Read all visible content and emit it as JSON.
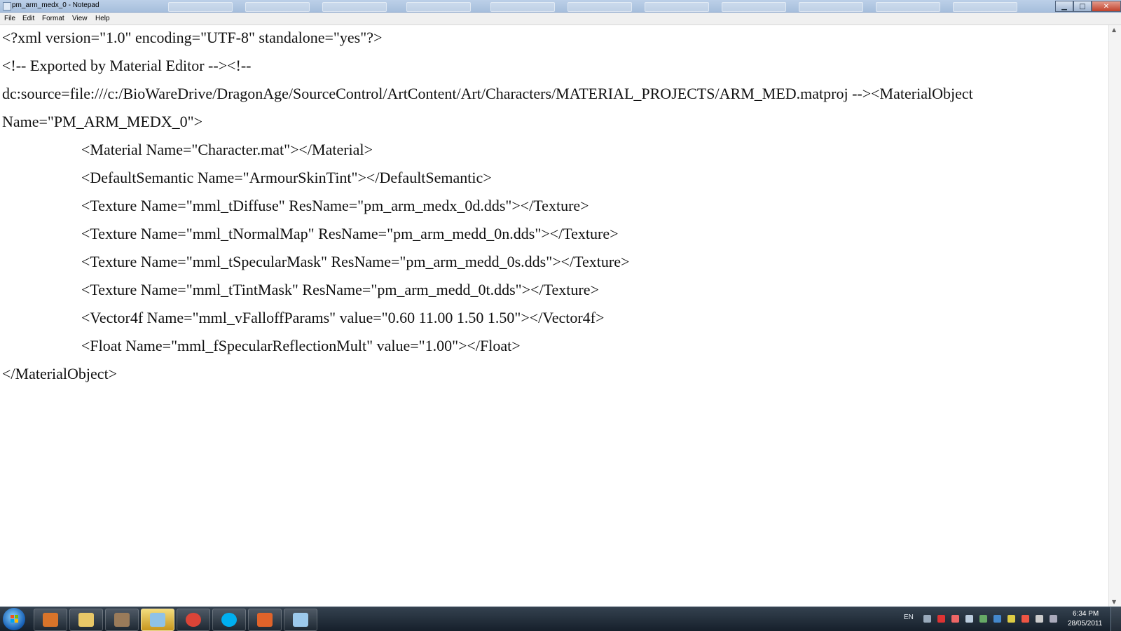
{
  "window": {
    "title": "pm_arm_medx_0 - Notepad",
    "controls": {
      "minimize": "▁",
      "maximize": "□",
      "close": "✕"
    }
  },
  "menu": [
    "File",
    "Edit",
    "Format",
    "View",
    "Help"
  ],
  "document": {
    "lines": [
      "<?xml version=\"1.0\" encoding=\"UTF-8\" standalone=\"yes\"?>",
      "<!-- Exported by Material Editor --><!--",
      "dc:source=file:///c:/BioWareDrive/DragonAge/SourceControl/ArtContent/Art/Characters/MATERIAL_PROJECTS/ARM_MED.matproj --><MaterialObject",
      "Name=\"PM_ARM_MEDX_0\">",
      "<Material Name=\"Character.mat\"></Material>",
      "<DefaultSemantic Name=\"ArmourSkinTint\"></DefaultSemantic>",
      "<Texture Name=\"mml_tDiffuse\" ResName=\"pm_arm_medx_0d.dds\"></Texture>",
      "<Texture Name=\"mml_tNormalMap\" ResName=\"pm_arm_medd_0n.dds\"></Texture>",
      "<Texture Name=\"mml_tSpecularMask\" ResName=\"pm_arm_medd_0s.dds\"></Texture>",
      "<Texture Name=\"mml_tTintMask\" ResName=\"pm_arm_medd_0t.dds\"></Texture>",
      "<Vector4f Name=\"mml_vFalloffParams\" value=\"0.60 11.00 1.50 1.50\"></Vector4f>",
      "<Float Name=\"mml_fSpecularReflectionMult\" value=\"1.00\"></Float>",
      "</MaterialObject>"
    ]
  },
  "taskbar": {
    "apps": [
      {
        "icon": "media-player-icon",
        "color": "#d9742a",
        "active": false
      },
      {
        "icon": "folder-icon",
        "color": "#e8c767",
        "active": false
      },
      {
        "icon": "game-icon",
        "color": "#9a7b5a",
        "active": false
      },
      {
        "icon": "users-icon",
        "color": "#8fc2e8",
        "active": true
      },
      {
        "icon": "chrome-icon",
        "color": "#db4437",
        "active": false
      },
      {
        "icon": "skype-icon",
        "color": "#00aff0",
        "active": false
      },
      {
        "icon": "office-icon",
        "color": "#e0632a",
        "active": false
      },
      {
        "icon": "notepad-icon",
        "color": "#9cc9ec",
        "active": false
      }
    ],
    "tray_language": "EN",
    "tray_icons": [
      "#9ab",
      "#d33",
      "#e66",
      "#bcd",
      "#6a6",
      "#48c",
      "#dc4",
      "#e54",
      "#ccc",
      "#aab"
    ],
    "clock_time": "6:34 PM",
    "clock_date": "28/05/2011"
  }
}
